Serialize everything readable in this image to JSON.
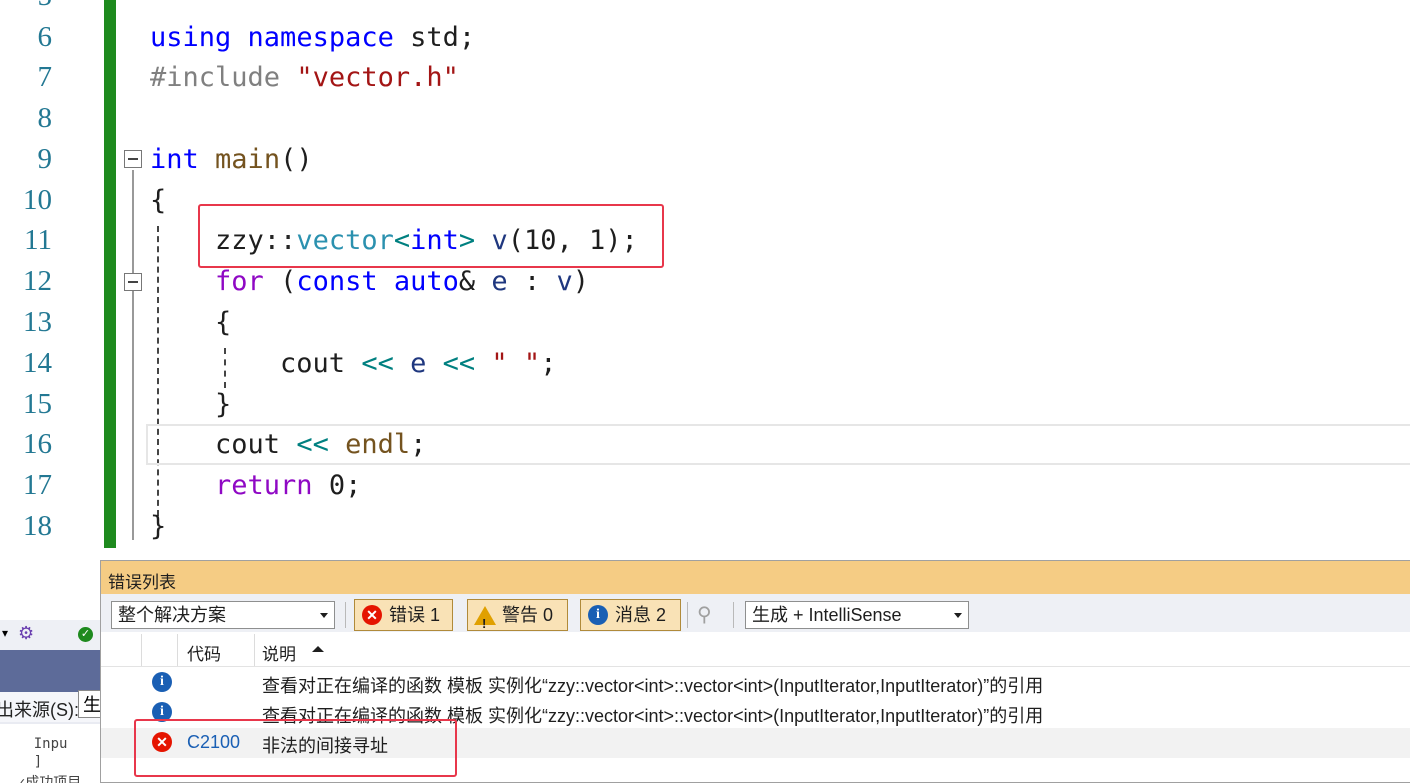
{
  "editor": {
    "line_numbers": [
      "6",
      "7",
      "8",
      "9",
      "10",
      "11",
      "12",
      "13",
      "14",
      "15",
      "16",
      "17",
      "18"
    ],
    "code": {
      "l6": [
        {
          "t": "using",
          "c": "kw"
        },
        {
          "t": " "
        },
        {
          "t": "namespace",
          "c": "kw"
        },
        {
          "t": " std;"
        }
      ],
      "l7": [
        {
          "t": "#include ",
          "c": "pp"
        },
        {
          "t": "\"vector.h\"",
          "c": "str"
        }
      ],
      "l9": [
        {
          "t": "int",
          "c": "kw"
        },
        {
          "t": " "
        },
        {
          "t": "main",
          "c": "fn"
        },
        {
          "t": "()"
        }
      ],
      "l10": [
        {
          "t": "{"
        }
      ],
      "l11": [
        {
          "t": "    zzy"
        },
        {
          "t": "::",
          "c": "ns"
        },
        {
          "t": "vector",
          "c": "ty"
        },
        {
          "t": "<",
          "c": "op"
        },
        {
          "t": "int",
          "c": "kw"
        },
        {
          "t": ">",
          "c": "op"
        },
        {
          "t": " "
        },
        {
          "t": "v",
          "c": "var"
        },
        {
          "t": "(10, 1);"
        }
      ],
      "l12": [
        {
          "t": "    "
        },
        {
          "t": "for",
          "c": "ctl"
        },
        {
          "t": " ("
        },
        {
          "t": "const",
          "c": "kw"
        },
        {
          "t": " "
        },
        {
          "t": "auto",
          "c": "kw"
        },
        {
          "t": "& "
        },
        {
          "t": "e",
          "c": "var"
        },
        {
          "t": " : "
        },
        {
          "t": "v",
          "c": "var"
        },
        {
          "t": ")"
        }
      ],
      "l13": [
        {
          "t": "    {"
        }
      ],
      "l14": [
        {
          "t": "        cout "
        },
        {
          "t": "<<",
          "c": "op"
        },
        {
          "t": " "
        },
        {
          "t": "e",
          "c": "var"
        },
        {
          "t": " "
        },
        {
          "t": "<<",
          "c": "op"
        },
        {
          "t": " "
        },
        {
          "t": "\" \"",
          "c": "str"
        },
        {
          "t": ";"
        }
      ],
      "l15": [
        {
          "t": "    }"
        }
      ],
      "l16": [
        {
          "t": "    cout "
        },
        {
          "t": "<<",
          "c": "op"
        },
        {
          "t": " "
        },
        {
          "t": "endl",
          "c": "fn"
        },
        {
          "t": ";"
        }
      ],
      "l17": [
        {
          "t": "    "
        },
        {
          "t": "return",
          "c": "ctl"
        },
        {
          "t": " 0;"
        }
      ],
      "l18": [
        {
          "t": "}"
        }
      ]
    }
  },
  "background_panel": {
    "source_label": "出来源(S):",
    "source_value": "生",
    "output_lines": [
      "    Inpu",
      "    ]",
      "  ✓成功项目"
    ]
  },
  "error_list": {
    "title": "错误列表",
    "scope_combo": "整个解决方案",
    "errors_btn": "错误 1",
    "warnings_btn": "警告 0",
    "messages_btn": "消息 2",
    "source_combo": "生成 + IntelliSense",
    "columns": {
      "code": "代码",
      "description": "说明"
    },
    "rows": [
      {
        "type": "info",
        "code": "",
        "description": "查看对正在编译的函数 模板 实例化“zzy::vector<int>::vector<int>(InputIterator,InputIterator)”的引用"
      },
      {
        "type": "info",
        "code": "",
        "description": "查看对正在编译的函数 模板 实例化“zzy::vector<int>::vector<int>(InputIterator,InputIterator)”的引用"
      },
      {
        "type": "error",
        "code": "C2100",
        "description": "非法的间接寻址"
      }
    ]
  },
  "colors": {
    "accent_green": "#1e8a1e",
    "highlight_red": "#e8374b",
    "tool_window_title": "#f5cc84"
  }
}
